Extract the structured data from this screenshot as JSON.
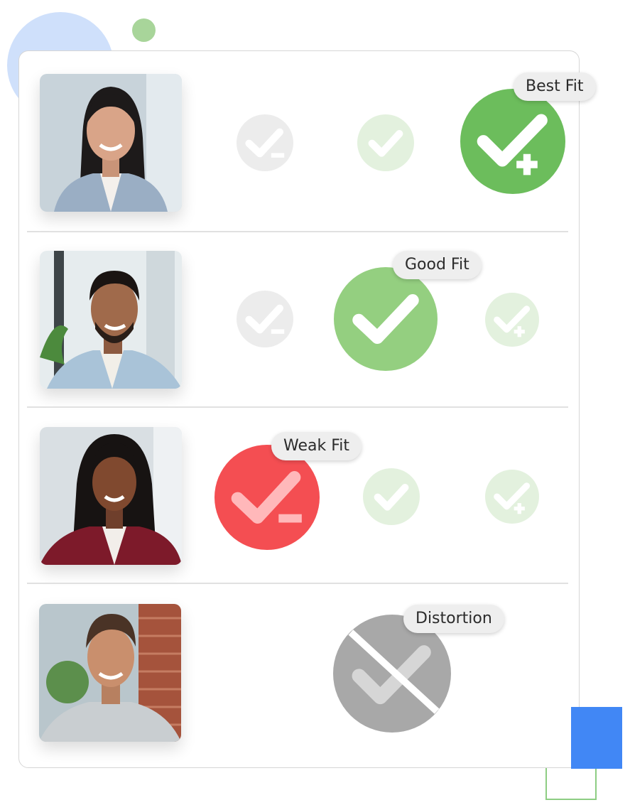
{
  "colors": {
    "best": "#6cbd5c",
    "good": "#94cf80",
    "weak": "#f44e52",
    "distortion": "#a8a8a8",
    "faded_gray": "#ececec",
    "faded_green": "#e3f1de",
    "accent_blue": "#4187f5"
  },
  "rows": [
    {
      "photo": "photo-woman-long-black-hair-gray-blazer",
      "badge": "Best Fit",
      "selected": "plus-check-icon"
    },
    {
      "photo": "photo-man-beard-light-blue-blazer",
      "badge": "Good Fit",
      "selected": "check-icon"
    },
    {
      "photo": "photo-woman-braids-burgundy-blazer",
      "badge": "Weak Fit",
      "selected": "minus-check-icon"
    },
    {
      "photo": "photo-man-smiling-gray-tshirt",
      "badge": "Distortion",
      "selected": "crossed-check-icon"
    }
  ]
}
